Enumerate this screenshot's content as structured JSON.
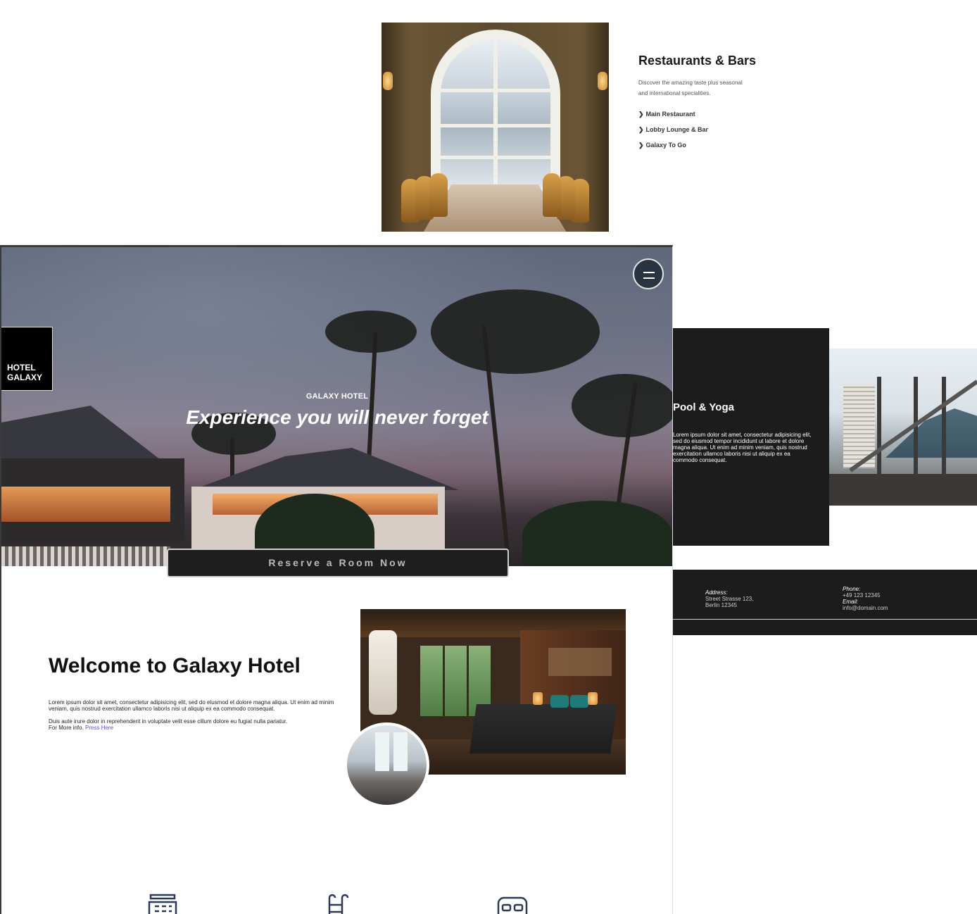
{
  "restaurants": {
    "title": "Restaurants & Bars",
    "description": "Discover the amazing taste plus seasonal and international specialities.",
    "links": [
      "Main Restaurant",
      "Lobby Lounge & Bar",
      "Galaxy To Go"
    ],
    "chevron": "❯"
  },
  "hero": {
    "logo_line1": "HOTEL",
    "logo_line2": "GALAXY",
    "kicker": "GALAXY HOTEL",
    "title": "Experience you will never forget",
    "reserve_label": "Reserve a Room Now",
    "menu_icon": "hamburger-icon"
  },
  "welcome": {
    "title": "Welcome to Galaxy Hotel",
    "paragraph1": "Lorem ipsum dolor sit amet, consectetur adipisicing elit, sed do eiusmod et dolore magna aliqua. Ut enim ad minim veniam, quis nostrud exercitation ullamco laboris nisi ut aliquip ex ea commodo consequat.",
    "paragraph2": "Duis aute irure dolor in reprehenderit in voluptate velit esse cillum dolore eu fugiat nulla pariatur.",
    "more_prefix": "For More info.",
    "more_link": "Press Here"
  },
  "features": {
    "icons": [
      "hotel-building-icon",
      "pool-ladder-icon",
      "bed-icon"
    ]
  },
  "pool": {
    "title": "Pool & Yoga",
    "description": "Lorem ipsum dolor sit amet, consectetur adipisicing elit, sed do eiusmod tempor incididunt ut labore et dolore magna aliqua. Ut enim ad minim veniam, quis nostrud exercitation ullamco laboris nisi ut aliquip ex ea commodo consequat."
  },
  "footer": {
    "address_label": "Address:",
    "address_line1": "Street Strasse 123,",
    "address_line2": "Berlin 12345",
    "phone_label": "Phone:",
    "phone_value": "+49 123 12345",
    "email_label": "Email:",
    "email_value": "info@domain.com"
  },
  "colors": {
    "dark_panel": "#1c1c1c",
    "link_purple": "#6b4cc6",
    "icon_navy": "#2b3a55"
  }
}
